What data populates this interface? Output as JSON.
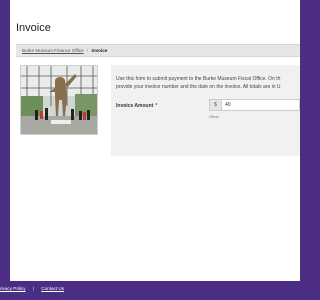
{
  "page": {
    "title": "Invoice"
  },
  "breadcrumb": {
    "parent": "Burke Museum Finance Office",
    "separator": "/",
    "current": "Invoice"
  },
  "photo": {
    "alt": "museum hall"
  },
  "form": {
    "intro_line1": "Use this form to submit payment to the Burke Museum Fiscal Office. On th",
    "intro_line2": "provide your invoice number and the date on the invoice. All totals are in U",
    "amount_label": "Invoice Amount",
    "required_mark": "*",
    "currency_symbol": "$",
    "amount_value": "40",
    "amount_hint": "Other"
  },
  "footer": {
    "privacy": "rivacy Policy",
    "separator": "|",
    "contact": "Contact Us"
  },
  "colors": {
    "brand_purple": "#4b2e83",
    "required_red": "#c0392b"
  }
}
